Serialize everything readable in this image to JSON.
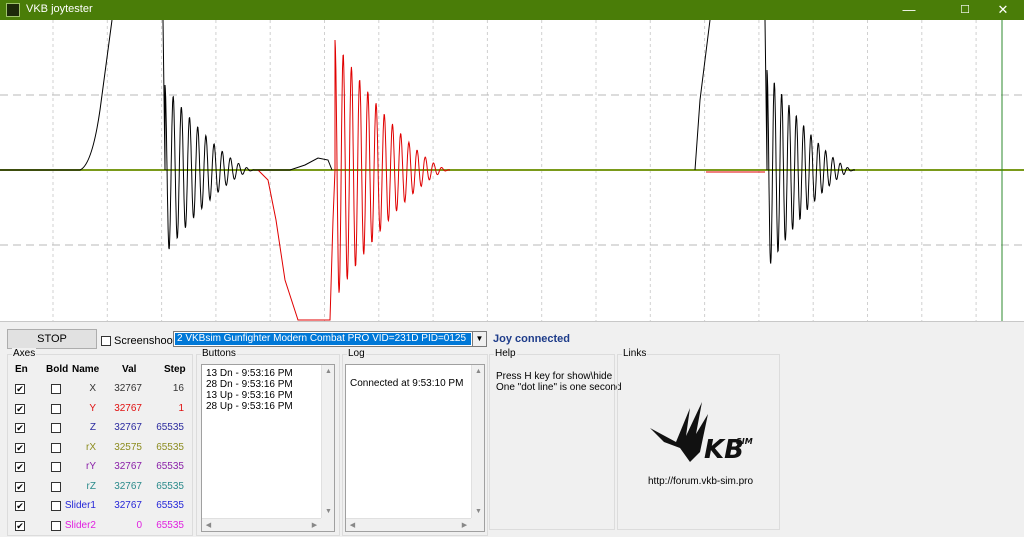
{
  "window": {
    "title": "VKB joytester"
  },
  "controls": {
    "stop_label": "STOP",
    "screenshoot_label": "Screenshoot",
    "device_selected": "2 VKBsim Gunfighter Modern Combat PRO  VID=231D PID=0125",
    "joy_status": "Joy connected"
  },
  "axes": {
    "title": "Axes",
    "headers": {
      "en": "En",
      "bold": "Bold",
      "name": "Name",
      "val": "Val",
      "step": "Step"
    },
    "rows": [
      {
        "name": "X",
        "val": "32767",
        "step": "16",
        "color": "#333333",
        "en": true,
        "bold": false
      },
      {
        "name": "Y",
        "val": "32767",
        "step": "1",
        "color": "#e01010",
        "en": true,
        "bold": false
      },
      {
        "name": "Z",
        "val": "32767",
        "step": "65535",
        "color": "#2a2aa0",
        "en": true,
        "bold": false
      },
      {
        "name": "rX",
        "val": "32575",
        "step": "65535",
        "color": "#8c8c1e",
        "en": true,
        "bold": false
      },
      {
        "name": "rY",
        "val": "32767",
        "step": "65535",
        "color": "#8a1fa8",
        "en": true,
        "bold": false
      },
      {
        "name": "rZ",
        "val": "32767",
        "step": "65535",
        "color": "#2a8a8a",
        "en": true,
        "bold": false
      },
      {
        "name": "Slider1",
        "val": "32767",
        "step": "65535",
        "color": "#2626d8",
        "en": true,
        "bold": false
      },
      {
        "name": "Slider2",
        "val": "0",
        "step": "65535",
        "color": "#e020e0",
        "en": true,
        "bold": false
      }
    ]
  },
  "buttons_panel": {
    "title": "Buttons",
    "lines": [
      "13 Dn - 9:53:16 PM",
      "28 Dn - 9:53:16 PM",
      "13 Up - 9:53:16 PM",
      "28 Up - 9:53:16 PM"
    ]
  },
  "log_panel": {
    "title": "Log",
    "lines": [
      "Connected at 9:53:10 PM"
    ]
  },
  "help_panel": {
    "title": "Help",
    "lines": [
      "Press H key for show\\hide",
      "One \"dot line\" is one second"
    ]
  },
  "links_panel": {
    "title": "Links",
    "logo_text": "KB",
    "logo_sup": "SIM",
    "url": "http://forum.vkb-sim.pro"
  },
  "colors": {
    "titlebar": "#4a7d08",
    "selection": "#0078d7",
    "trace_x": "#000000",
    "trace_y": "#e00000",
    "center_line": "#7a9a1a",
    "cursor_line": "#2e8a2e"
  },
  "icons": [
    "app-icon",
    "minimize-icon",
    "maximize-icon",
    "close-icon",
    "dropdown-arrow-icon",
    "checkbox-icon",
    "vkb-logo-icon"
  ]
}
